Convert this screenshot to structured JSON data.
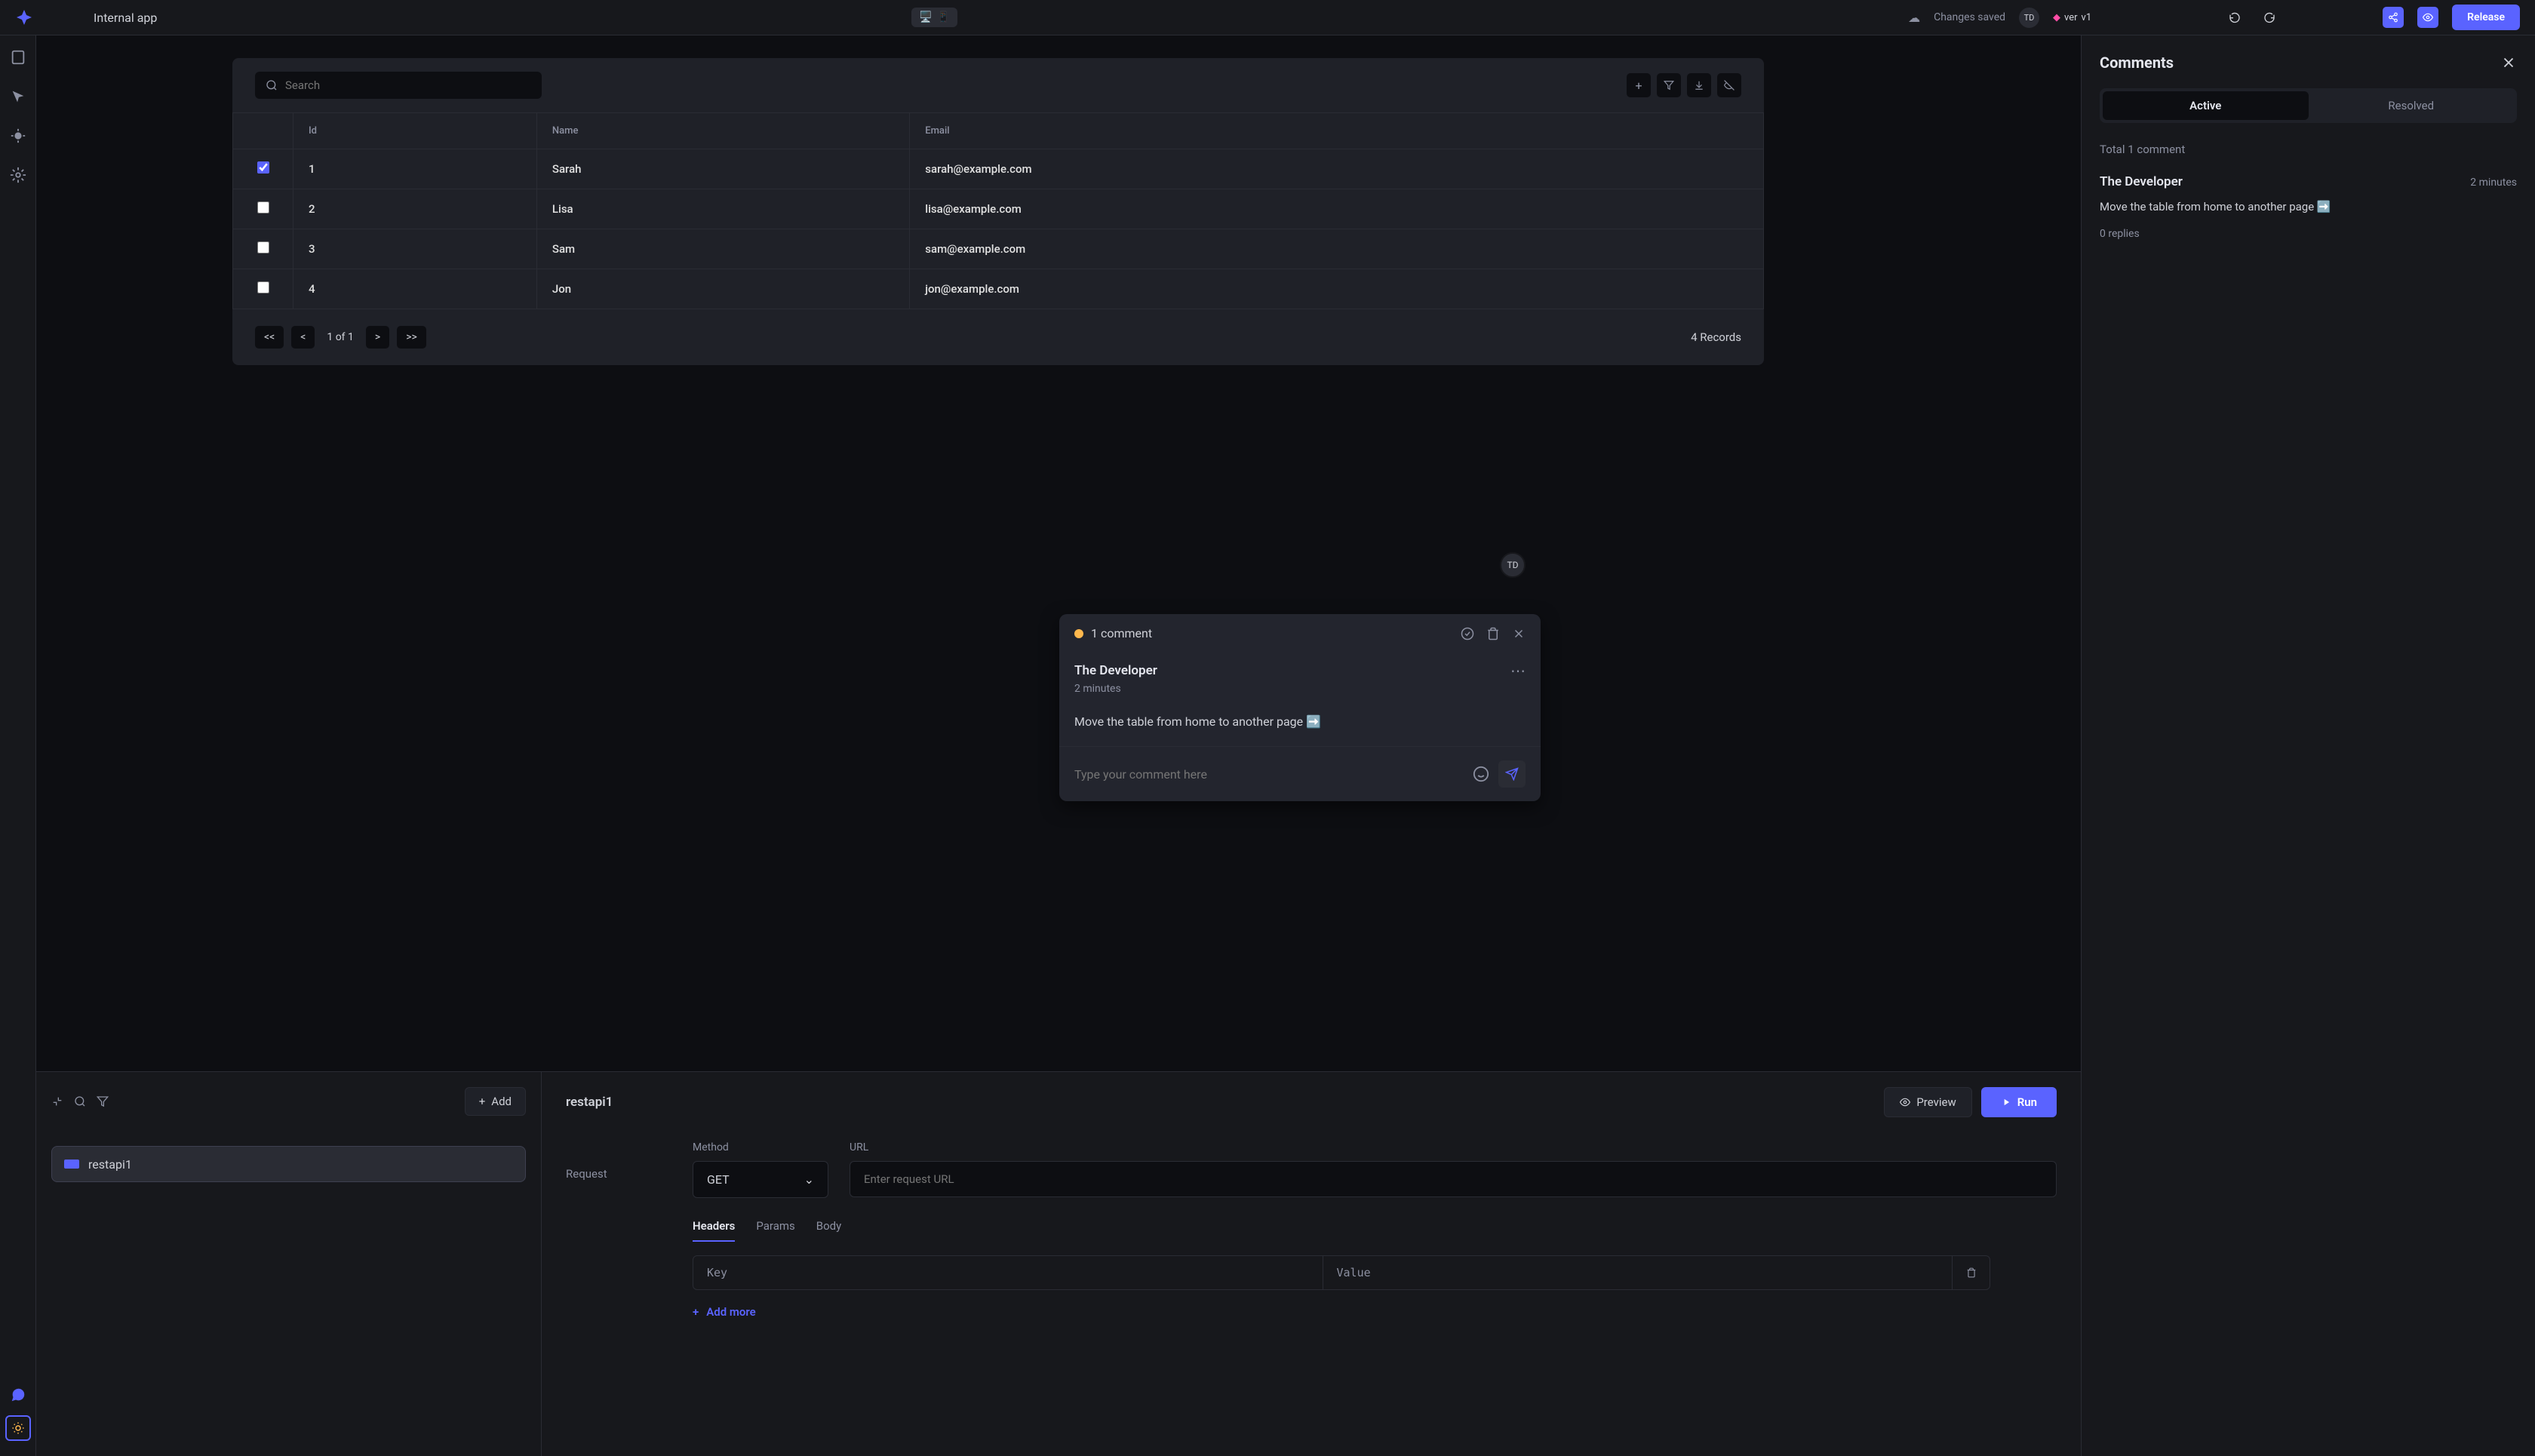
{
  "header": {
    "app_title": "Internal app",
    "saved": "Changes saved",
    "avatar": "TD",
    "ver_label": "ver",
    "ver_value": "v1",
    "release": "Release"
  },
  "table": {
    "search_placeholder": "Search",
    "columns": [
      "Id",
      "Name",
      "Email"
    ],
    "rows": [
      {
        "checked": true,
        "id": "1",
        "name": "Sarah",
        "email": "sarah@example.com"
      },
      {
        "checked": false,
        "id": "2",
        "name": "Lisa",
        "email": "lisa@example.com"
      },
      {
        "checked": false,
        "id": "3",
        "name": "Sam",
        "email": "sam@example.com"
      },
      {
        "checked": false,
        "id": "4",
        "name": "Jon",
        "email": "jon@example.com"
      }
    ],
    "pagination": {
      "first": "<<",
      "prev": "<",
      "info": "1 of 1",
      "next": ">",
      "last": ">>"
    },
    "records": "4 Records"
  },
  "floating_avatar": "TD",
  "popover": {
    "count_label": "1 comment",
    "author": "The Developer",
    "time": "2 minutes",
    "text": "Move the table from home to another page ➡️",
    "input_placeholder": "Type your comment here"
  },
  "bottom": {
    "add_label": "Add",
    "query_name": "restapi1",
    "title": "restapi1",
    "preview": "Preview",
    "run": "Run",
    "request_label": "Request",
    "method_label": "Method",
    "method_value": "GET",
    "url_label": "URL",
    "url_placeholder": "Enter request URL",
    "tabs": {
      "headers": "Headers",
      "params": "Params",
      "body": "Body"
    },
    "key_placeholder": "Key",
    "value_placeholder": "Value",
    "add_more": "Add more"
  },
  "comments_panel": {
    "title": "Comments",
    "seg_active": "Active",
    "seg_resolved": "Resolved",
    "total": "Total 1 comment",
    "author": "The Developer",
    "time": "2 minutes",
    "text": "Move the table from home to another page ➡️",
    "replies": "0 replies"
  }
}
